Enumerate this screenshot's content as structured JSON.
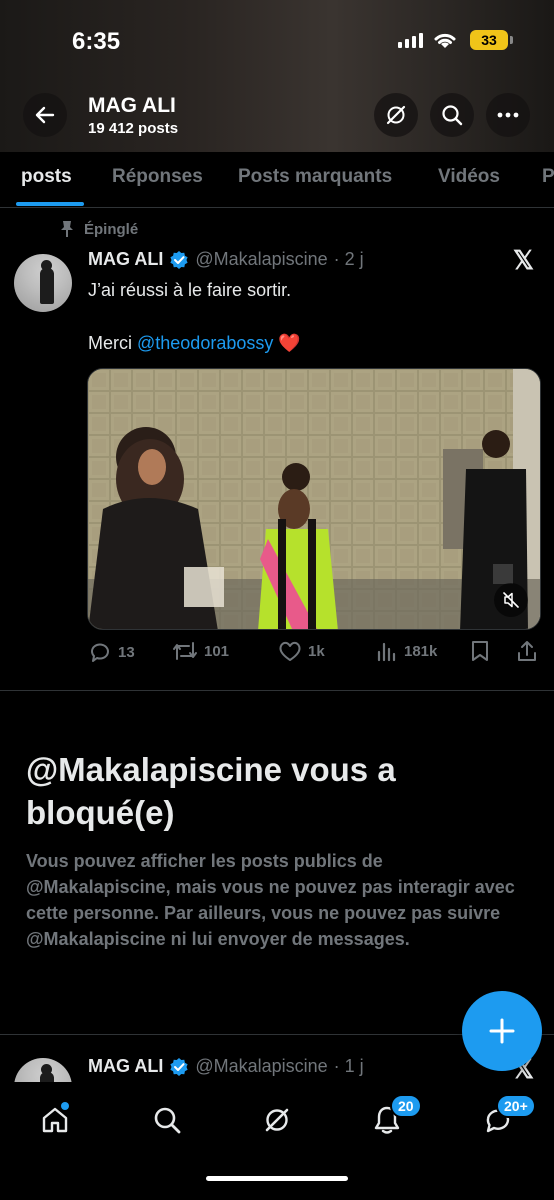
{
  "status_bar": {
    "time": "6:35",
    "battery": "33"
  },
  "header": {
    "title": "MAG ALI",
    "subtitle": "19 412 posts"
  },
  "tabs": [
    {
      "label": "posts",
      "active": true
    },
    {
      "label": "Réponses"
    },
    {
      "label": "Posts marquants"
    },
    {
      "label": "Vidéos"
    },
    {
      "label": "P"
    }
  ],
  "pinned_post": {
    "pin_label": "Épinglé",
    "author": "MAG ALI",
    "handle": "@Makalapiscine",
    "time": "· 2 j",
    "text_line1": "J’ai réussi à le faire sortir.",
    "text_prefix": "Merci ",
    "mention": "@theodorabossy",
    "emoji": "❤️",
    "stats": {
      "replies": "13",
      "reposts": "101",
      "likes": "1k",
      "views": "181k"
    }
  },
  "blocked": {
    "title": "@Makalapiscine vous a bloqué(e)",
    "body": "Vous pouvez afficher les posts publics de @Makalapiscine, mais vous ne pouvez pas interagir avec cette personne. Par ailleurs, vous ne pouvez pas suivre @Makalapiscine ni lui envoyer de messages."
  },
  "second_post": {
    "author": "MAG ALI",
    "handle": "@Makalapiscine",
    "time": "· 1 j"
  },
  "bottom_nav": {
    "notifications_badge": "20",
    "messages_badge": "20+"
  },
  "colors": {
    "accent": "#1d9bf0",
    "background": "#000000",
    "secondary_text": "#71767b",
    "battery": "#f0c419"
  }
}
